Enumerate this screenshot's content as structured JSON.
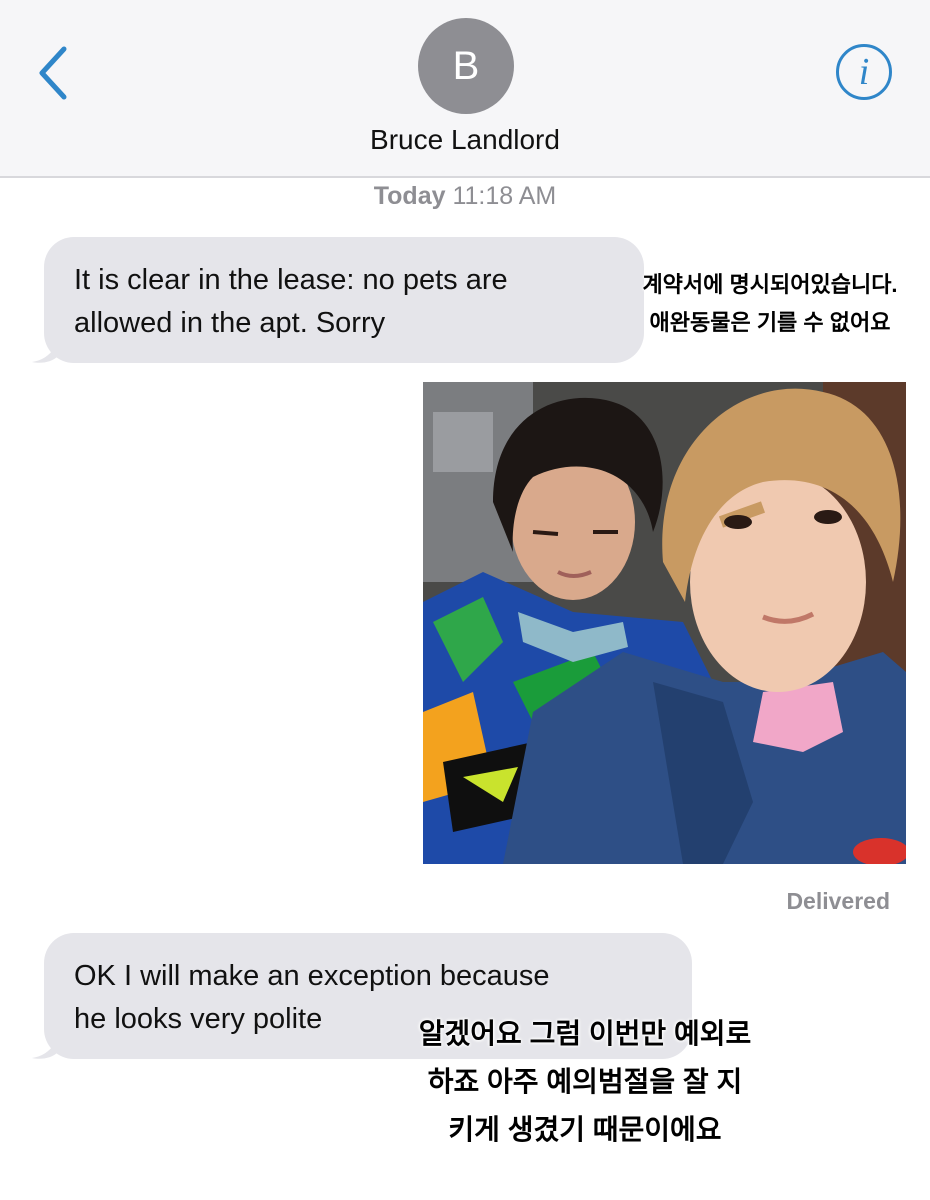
{
  "header": {
    "back_icon": "chevron-left-icon",
    "avatar_initial": "B",
    "contact_name": "Bruce Landlord",
    "info_icon": "info-circle-icon",
    "info_glyph": "i",
    "accent_color": "#2f86c9"
  },
  "thread": {
    "timestamp_day": "Today",
    "timestamp_time": "11:18 AM",
    "messages": [
      {
        "direction": "incoming",
        "lines": [
          "It is clear in the lease: no pets are",
          "allowed in the apt. Sorry"
        ],
        "subtitle_lines": [
          "계약서에 명시되어있습니다.",
          "애완동물은 기를 수 없어요"
        ]
      },
      {
        "direction": "outgoing",
        "type": "photo",
        "status": "Delivered"
      },
      {
        "direction": "incoming",
        "lines": [
          "OK I will make an exception because",
          "he looks very polite"
        ],
        "subtitle_lines": [
          "알겠어요 그럼 이번만 예외로",
          "하죠 아주 예의범절을 잘 지",
          "키게 생겼기 때문이에요"
        ]
      }
    ]
  },
  "colors": {
    "incoming_bubble": "#e5e5ea",
    "header_bg": "#f6f6f8",
    "avatar_bg": "#8e8e93",
    "meta_text": "#8e8e93"
  }
}
